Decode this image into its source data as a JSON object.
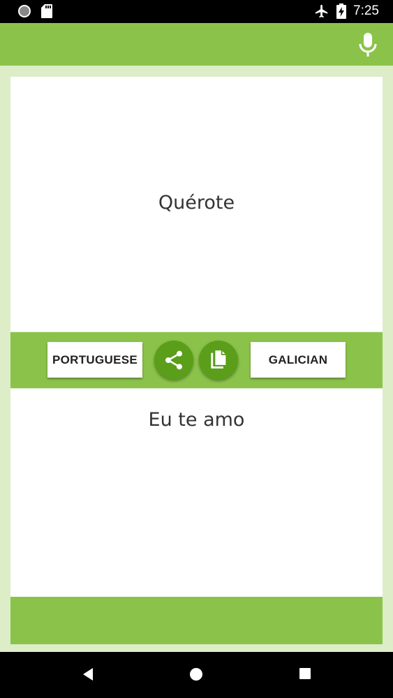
{
  "status_bar": {
    "time": "7:25",
    "icons": [
      "circle-notification-icon",
      "sd-card-icon",
      "airplane-mode-icon",
      "battery-charging-icon"
    ]
  },
  "app_bar": {
    "actions": [
      "microphone-icon"
    ]
  },
  "source": {
    "text": "Quérote"
  },
  "target": {
    "text": "Eu te amo"
  },
  "toolbar": {
    "source_language": "PORTUGUESE",
    "target_language": "GALICIAN",
    "actions": [
      "share-icon",
      "copy-icon"
    ]
  },
  "nav_bar": {
    "buttons": [
      "back-icon",
      "home-icon",
      "recents-icon"
    ]
  },
  "colors": {
    "primary": "#8bc34a",
    "primary_dark": "#5a9e1a",
    "background": "#dcedc8"
  }
}
